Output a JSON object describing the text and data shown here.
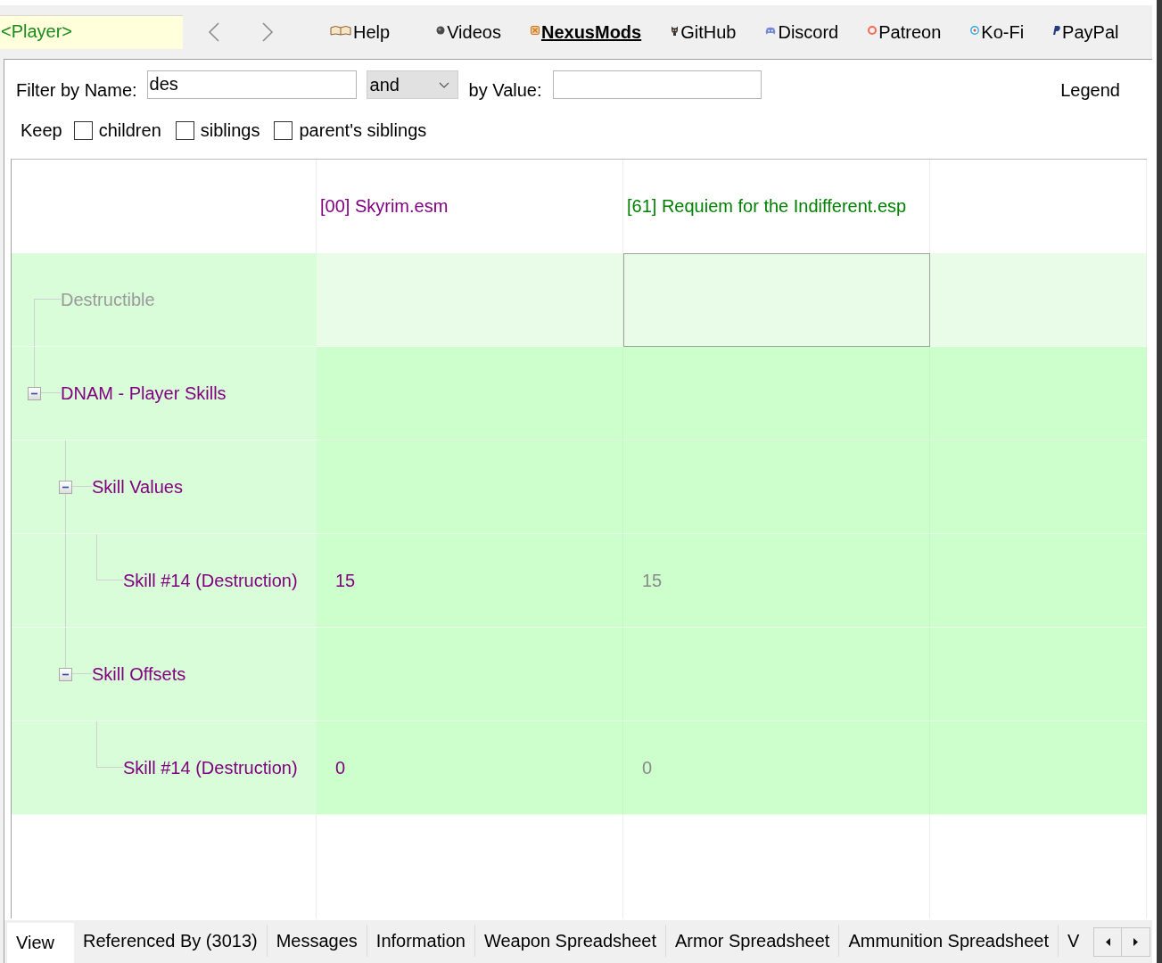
{
  "record": {
    "value": "<Player>"
  },
  "links": [
    {
      "label": "Help",
      "emphasized": false
    },
    {
      "label": "Videos",
      "emphasized": false
    },
    {
      "label": "NexusMods",
      "emphasized": true
    },
    {
      "label": "GitHub",
      "emphasized": false
    },
    {
      "label": "Discord",
      "emphasized": false
    },
    {
      "label": "Patreon",
      "emphasized": false
    },
    {
      "label": "Ko-Fi",
      "emphasized": false
    },
    {
      "label": "PayPal",
      "emphasized": false
    }
  ],
  "filter": {
    "name_label": "Filter by Name:",
    "name_value": "des",
    "operator": "and",
    "value_label": "by Value:",
    "legend": "Legend"
  },
  "keep": {
    "label": "Keep",
    "options": [
      {
        "label": "children",
        "checked": false
      },
      {
        "label": "siblings",
        "checked": false
      },
      {
        "label": "parent's siblings",
        "checked": false
      }
    ]
  },
  "grid": {
    "columns": [
      {
        "label": "[00] Skyrim.esm",
        "color": "#800080"
      },
      {
        "label": "[61] Requiem for the Indifferent.esp",
        "color": "#008000"
      }
    ],
    "rows": [
      {
        "label": "Destructible",
        "dimmed": true,
        "color": "#e8fce8",
        "cells": [
          {
            "selected": false
          },
          {
            "selected": true
          }
        ]
      },
      {
        "label": "DNAM - Player Skills",
        "dimmed": false,
        "expanded": true,
        "color": "#ccffcc",
        "cells": [
          {
            "selected": false
          },
          {
            "selected": false
          }
        ],
        "children": [
          {
            "label": "Skill Values",
            "dimmed": false,
            "expanded": true,
            "color": "#ccffcc",
            "cells": [
              {
                "selected": false
              },
              {
                "selected": false
              }
            ],
            "children": [
              {
                "label": "Skill #14 (Destruction)",
                "dimmed": false,
                "color": "#ccffcc",
                "cells": [
                  {
                    "value": "15",
                    "dimmed": false,
                    "selected": false
                  },
                  {
                    "value": "15",
                    "dimmed": true,
                    "selected": false
                  }
                ]
              }
            ]
          },
          {
            "label": "Skill Offsets",
            "dimmed": false,
            "expanded": true,
            "color": "#ccffcc",
            "cells": [
              {
                "selected": false
              },
              {
                "selected": false
              }
            ],
            "children": [
              {
                "label": "Skill #14 (Destruction)",
                "dimmed": false,
                "color": "#ccffcc",
                "cells": [
                  {
                    "value": "0",
                    "dimmed": false,
                    "selected": false
                  },
                  {
                    "value": "0",
                    "dimmed": true,
                    "selected": false
                  }
                ]
              }
            ]
          }
        ]
      }
    ]
  },
  "tabs": [
    {
      "label": "View",
      "selected": true
    },
    {
      "label": "Referenced By (3013)",
      "selected": false
    },
    {
      "label": "Messages",
      "selected": false
    },
    {
      "label": "Information",
      "selected": false
    },
    {
      "label": "Weapon Spreadsheet",
      "selected": false
    },
    {
      "label": "Armor Spreadsheet",
      "selected": false
    },
    {
      "label": "Ammunition Spreadsheet",
      "selected": false
    },
    {
      "label": "V",
      "selected": false
    }
  ]
}
